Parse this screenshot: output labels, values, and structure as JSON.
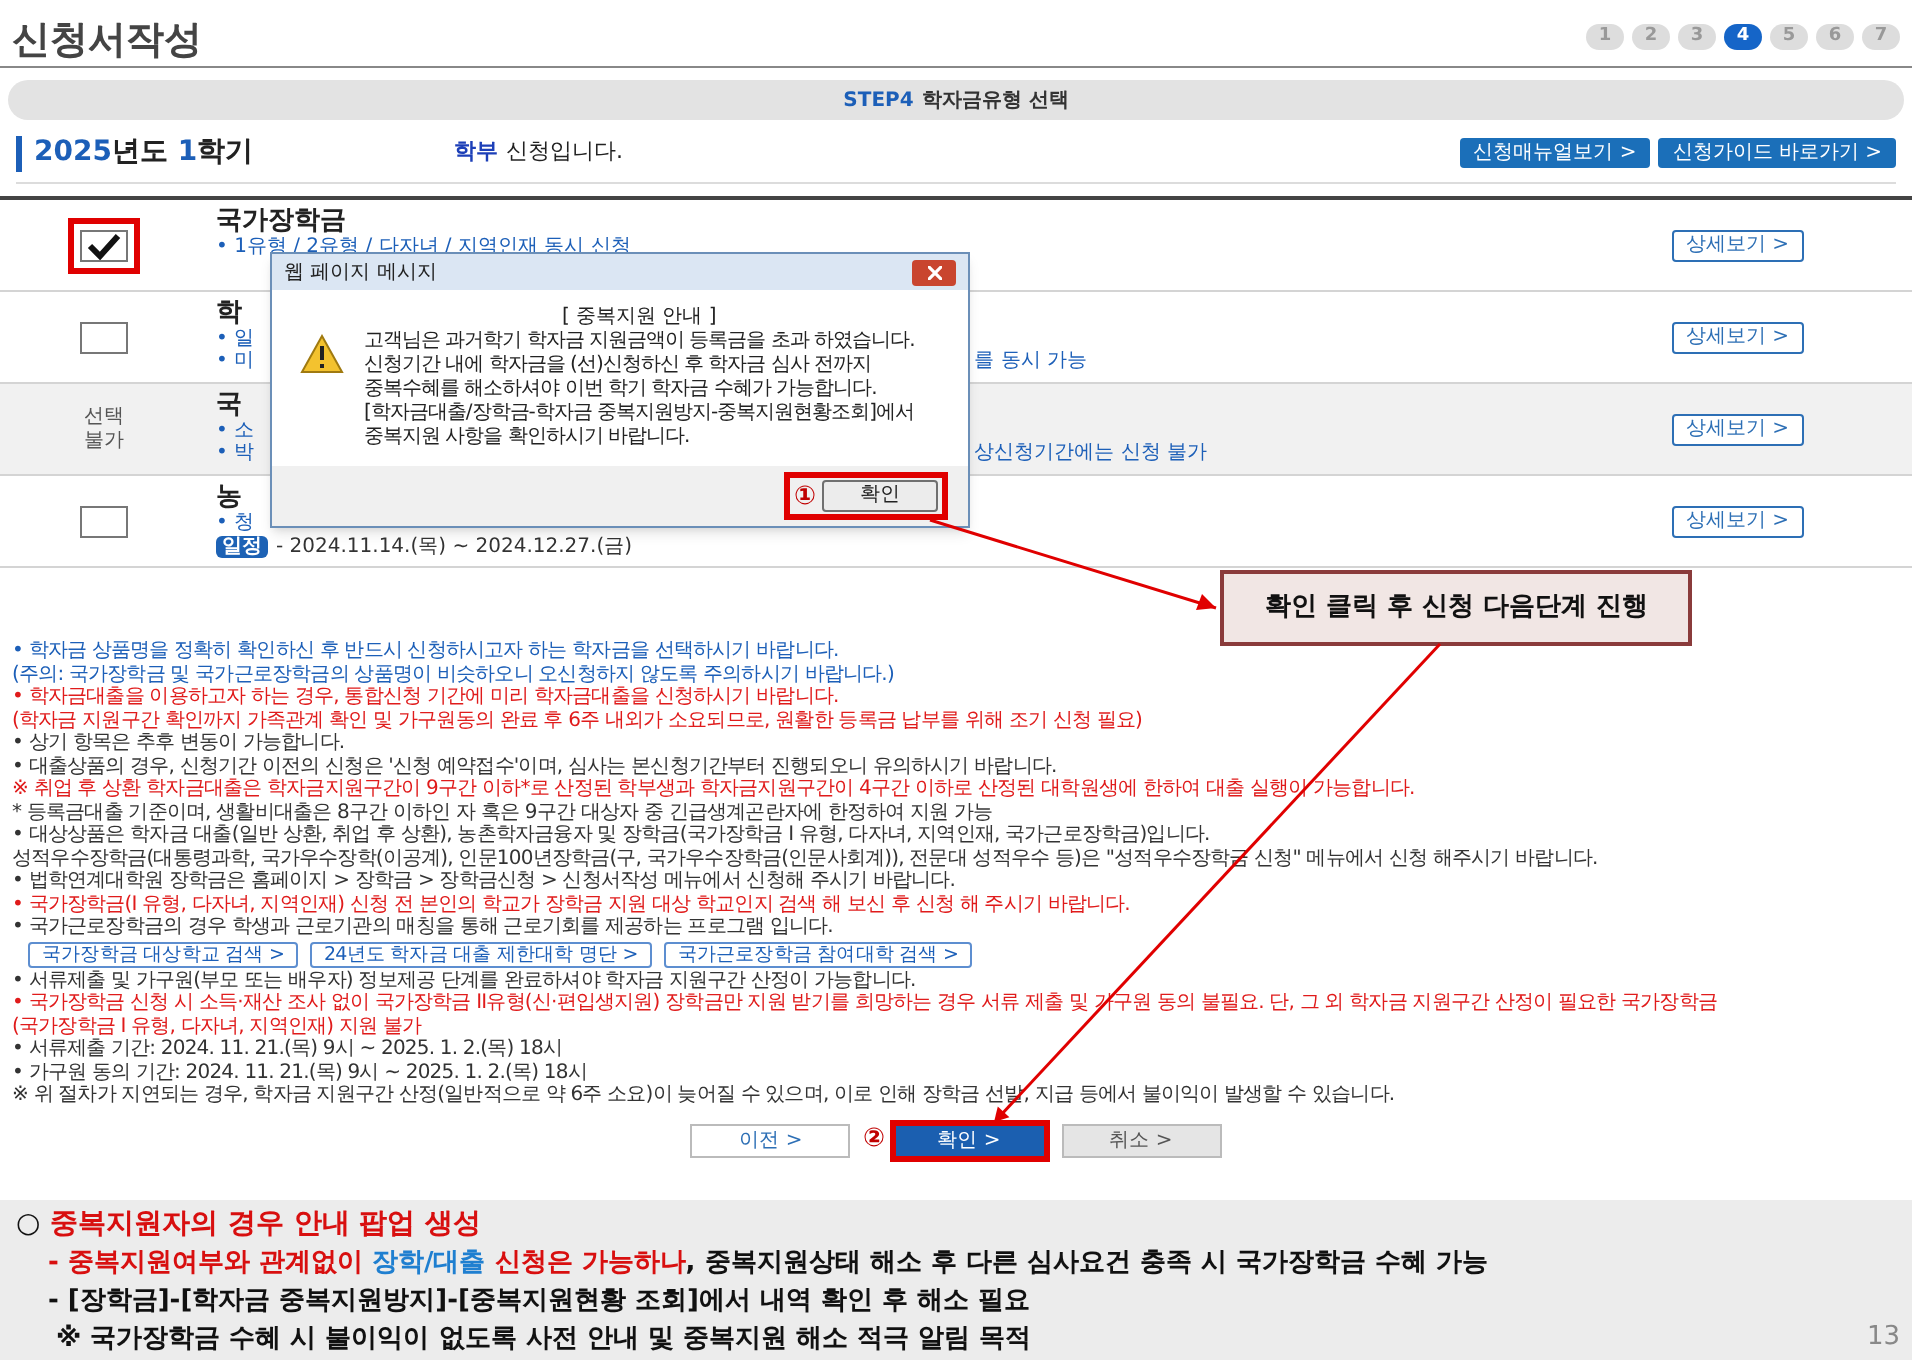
{
  "page_title": "신청서작성",
  "steps": [
    {
      "label": "1",
      "selected": false
    },
    {
      "label": "2",
      "selected": false
    },
    {
      "label": "3",
      "selected": false
    },
    {
      "label": "4",
      "selected": true
    },
    {
      "label": "5",
      "selected": false
    },
    {
      "label": "6",
      "selected": false
    },
    {
      "label": "7",
      "selected": false
    }
  ],
  "step_bar": {
    "step": "STEP4",
    "title": "학자금유형 선택"
  },
  "semester": [
    {
      "text": "2025",
      "highlight": true
    },
    {
      "text": "년도 ",
      "highlight": false
    },
    {
      "text": "1",
      "highlight": true
    },
    {
      "text": "학기",
      "highlight": false
    }
  ],
  "notice": {
    "category": "학부",
    "text": "신청입니다."
  },
  "guide_buttons": [
    "신청매뉴얼보기 >",
    "신청가이드 바로가기 >"
  ],
  "rows": [
    {
      "kind": "checkbox",
      "checked": true,
      "highlighted": true,
      "title": "국가장학금",
      "lines": [
        "• 1유형 / 2유형 / 다자녀 / 지역인재 동시 신청"
      ],
      "tail": "",
      "detail": "상세보기 >"
    },
    {
      "kind": "checkbox",
      "checked": false,
      "highlighted": false,
      "title": "학",
      "lines": [
        "• 일",
        "• 미"
      ],
      "tail": "를 동시 가능",
      "detail": "상세보기 >"
    },
    {
      "kind": "unavailable",
      "label": "선택 불가",
      "title": "국",
      "lines": [
        "• 소",
        "• 박"
      ],
      "tail": "상신청기간에는 신청 불가",
      "detail": "상세보기 >"
    },
    {
      "kind": "checkbox",
      "checked": false,
      "highlighted": false,
      "title": "농",
      "lines": [
        "• 청"
      ],
      "badge": "일정",
      "period": "- 2024.11.14.(목) ~ 2024.12.27.(금)",
      "tail": "",
      "detail": "상세보기 >"
    }
  ],
  "dialog": {
    "title": "웹 페이지 메시지",
    "heading": "[ 중복지원 안내 ]",
    "lines": [
      "고객님은 과거학기 학자금 지원금액이 등록금을 초과 하였습니다.",
      "신청기간 내에 학자금을 (선)신청하신 후 학자금 심사 전까지",
      "중복수혜를 해소하셔야 이번 학기 학자금 수혜가 가능합니다.",
      "[학자금대출/장학금-학자금 중복지원방지-중복지원현황조회]에서",
      "중복지원 사항을 확인하시기 바랍니다."
    ],
    "button": "확인",
    "marker": "①"
  },
  "callout": "확인 클릭 후 신청 다음단계 진행",
  "notes": [
    {
      "kind": "text",
      "color": "#1c5fb8",
      "text": "• 학자금 상품명을 정확히 확인하신 후 반드시 신청하시고자 하는 학자금을 선택하시기 바랍니다."
    },
    {
      "kind": "text",
      "color": "#1c5fb8",
      "text": "(주의: 국가장학금 및 국가근로장학금의 상품명이 비슷하오니 오신청하지 않도록 주의하시기 바랍니다.)"
    },
    {
      "kind": "text",
      "color": "#e01b1b",
      "text": "• 학자금대출을 이용하고자 하는 경우, 통합신청 기간에 미리 학자금대출을 신청하시기 바랍니다."
    },
    {
      "kind": "text",
      "color": "#e01b1b",
      "text": "(학자금 지원구간 확인까지 가족관계 확인 및 가구원동의 완료 후 6주 내외가 소요되므로, 원활한 등록금 납부를 위해 조기 신청 필요)"
    },
    {
      "kind": "text",
      "color": "#333333",
      "text": "• 상기 항목은 추후 변동이 가능합니다."
    },
    {
      "kind": "text",
      "color": "#333333",
      "text": "• 대출상품의 경우, 신청기간 이전의 신청은 '신청 예약접수'이며, 심사는 본신청기간부터 진행되오니 유의하시기 바랍니다."
    },
    {
      "kind": "text",
      "color": "#e01b1b",
      "text": "※ 취업 후 상환 학자금대출은 학자금지원구간이 9구간 이하*로 산정된 학부생과 학자금지원구간이 4구간 이하로 산정된 대학원생에 한하여 대출 실행이 가능합니다."
    },
    {
      "kind": "text",
      "color": "#333333",
      "text": "* 등록금대출 기준이며, 생활비대출은 8구간 이하인 자 혹은 9구간 대상자 중 긴급생계곤란자에 한정하여 지원 가능"
    },
    {
      "kind": "text",
      "color": "#333333",
      "text": "• 대상상품은 학자금 대출(일반 상환, 취업 후 상환), 농촌학자금융자 및 장학금(국가장학금 I 유형, 다자녀, 지역인재, 국가근로장학금)입니다."
    },
    {
      "kind": "text",
      "color": "#333333",
      "text": "성적우수장학금(대통령과학, 국가우수장학(이공계), 인문100년장학금(구, 국가우수장학금(인문사회계)), 전문대 성적우수 등)은 \"성적우수장학금 신청\" 메뉴에서 신청 해주시기 바랍니다."
    },
    {
      "kind": "text",
      "color": "#333333",
      "text": "• 법학연계대학원 장학금은 홈페이지 > 장학금 > 장학금신청 > 신청서작성 메뉴에서 신청해 주시기 바랍니다."
    },
    {
      "kind": "text",
      "color": "#e01b1b",
      "text": "• 국가장학금(I 유형, 다자녀, 지역인재) 신청 전 본인의 학교가 장학금 지원 대상 학교인지 검색 해 보신 후 신청 해 주시기 바랍니다."
    },
    {
      "kind": "text",
      "color": "#333333",
      "text": "• 국가근로장학금의 경우 학생과 근로기관의 매칭을 통해 근로기회를 제공하는 프로그램 입니다."
    },
    {
      "kind": "links",
      "items": [
        "국가장학금 대상학교 검색 >",
        "24년도 학자금 대출 제한대학 명단 >",
        "국가근로장학금 참여대학 검색 >"
      ]
    },
    {
      "kind": "text",
      "color": "#333333",
      "text": "• 서류제출 및 가구원(부모 또는 배우자) 정보제공 단계를 완료하셔야 학자금 지원구간 산정이 가능합니다."
    },
    {
      "kind": "text",
      "color": "#e01b1b",
      "text": "• 국가장학금 신청 시 소득·재산 조사 없이 국가장학금 II유형(신·편입생지원) 장학금만 지원 받기를 희망하는 경우 서류 제출 및 가구원 동의 불필요. 단, 그 외 학자금 지원구간 산정이 필요한 국가장학금"
    },
    {
      "kind": "text",
      "color": "#e01b1b",
      "text": "(국가장학금 I 유형, 다자녀, 지역인재) 지원 불가"
    },
    {
      "kind": "text",
      "color": "#333333",
      "text": "• 서류제출 기간: 2024. 11. 21.(목) 9시 ~ 2025. 1. 2.(목) 18시"
    },
    {
      "kind": "text",
      "color": "#333333",
      "text": "• 가구원 동의 기간: 2024. 11. 21.(목) 9시 ~ 2025. 1. 2.(목) 18시"
    },
    {
      "kind": "text",
      "color": "#333333",
      "text": "※ 위 절차가 지연되는 경우, 학자금 지원구간 산정(일반적으로 약 6주 소요)이 늦어질 수 있으며, 이로 인해 장학금 선발, 지급 등에서 불이익이 발생할 수 있습니다."
    }
  ],
  "actions": [
    {
      "label": "이전 >",
      "kind": "plain"
    },
    {
      "label": "확인 >",
      "kind": "primary",
      "marker": "②"
    },
    {
      "label": "취소 >",
      "kind": "muted"
    }
  ],
  "summary": {
    "heading": [
      {
        "text": "○ ",
        "color": "#111111"
      },
      {
        "text": "중복지원자의 경우 안내 팝업 생성",
        "color": "#d80f0f"
      }
    ],
    "lines": [
      [
        {
          "text": "- 중복지원여부와 관계없이 ",
          "color": "#d80f0f"
        },
        {
          "text": "장학/대출",
          "color": "#1f7fd0"
        },
        {
          "text": " 신청은 가능하나",
          "color": "#d80f0f"
        },
        {
          "text": ", 중복지원상태 해소 후 다른 심사요건 충족 시 국가장학금 수혜 가능",
          "color": "#111111"
        }
      ],
      [
        {
          "text": "- [장학금]-[학자금 중복지원방지]-[중복지원현황 조회]에서 내역 확인 후 해소 필요",
          "color": "#111111"
        }
      ],
      [
        {
          "text": "※ 국가장학금 수혜 시 불이익이 없도록 사전 안내 및 중복지원 해소 적극 알림 목적",
          "color": "#111111"
        }
      ]
    ],
    "page_number": "13"
  }
}
